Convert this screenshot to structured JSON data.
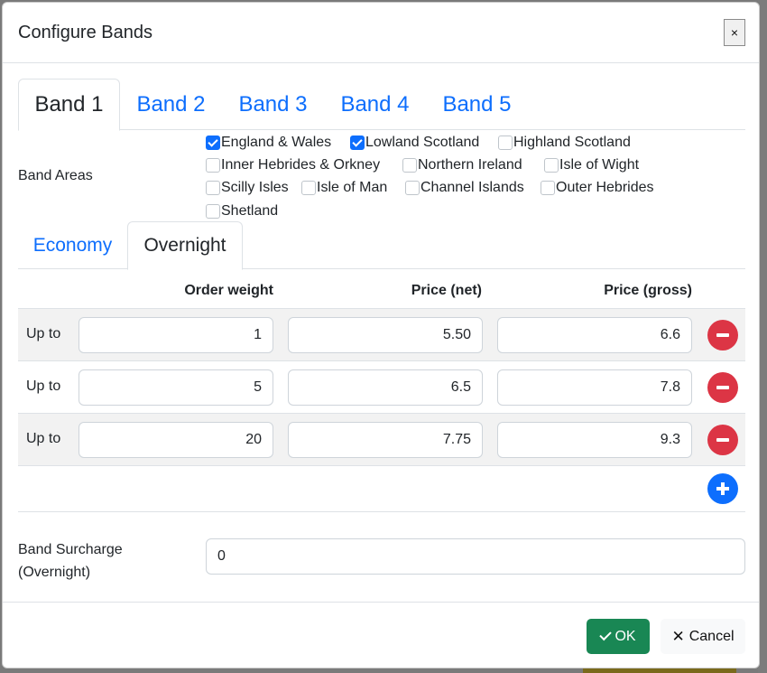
{
  "dialog": {
    "title": "Configure Bands",
    "close_label": "×"
  },
  "band_tabs": [
    {
      "label": "Band 1",
      "active": true
    },
    {
      "label": "Band 2",
      "active": false
    },
    {
      "label": "Band 3",
      "active": false
    },
    {
      "label": "Band 4",
      "active": false
    },
    {
      "label": "Band 5",
      "active": false
    }
  ],
  "band_areas": {
    "label": "Band Areas",
    "options": [
      {
        "label": "England & Wales",
        "checked": true
      },
      {
        "label": "Lowland Scotland",
        "checked": true
      },
      {
        "label": "Highland Scotland",
        "checked": false
      },
      {
        "label": "Inner Hebrides & Orkney",
        "checked": false
      },
      {
        "label": "Northern Ireland",
        "checked": false
      },
      {
        "label": "Isle of Wight",
        "checked": false
      },
      {
        "label": "Scilly Isles",
        "checked": false
      },
      {
        "label": "Isle of Man",
        "checked": false
      },
      {
        "label": "Channel Islands",
        "checked": false
      },
      {
        "label": "Outer Hebrides",
        "checked": false
      },
      {
        "label": "Shetland",
        "checked": false
      }
    ]
  },
  "service_tabs": [
    {
      "label": "Economy",
      "active": false
    },
    {
      "label": "Overnight",
      "active": true
    }
  ],
  "table": {
    "headers": {
      "weight": "Order weight",
      "net": "Price (net)",
      "gross": "Price (gross)"
    },
    "rows": [
      {
        "prefix": "Up to",
        "weight": "1",
        "net": "5.50",
        "gross": "6.6"
      },
      {
        "prefix": "Up to",
        "weight": "5",
        "net": "6.5",
        "gross": "7.8"
      },
      {
        "prefix": "Up to",
        "weight": "20",
        "net": "7.75",
        "gross": "9.3"
      }
    ]
  },
  "surcharge": {
    "label_line1": "Band Surcharge",
    "label_line2": "(Overnight)",
    "value": "0"
  },
  "footer": {
    "ok_label": "OK",
    "cancel_label": "Cancel"
  },
  "colors": {
    "primary": "#0d6efd",
    "danger": "#dc3545",
    "success": "#198754"
  }
}
